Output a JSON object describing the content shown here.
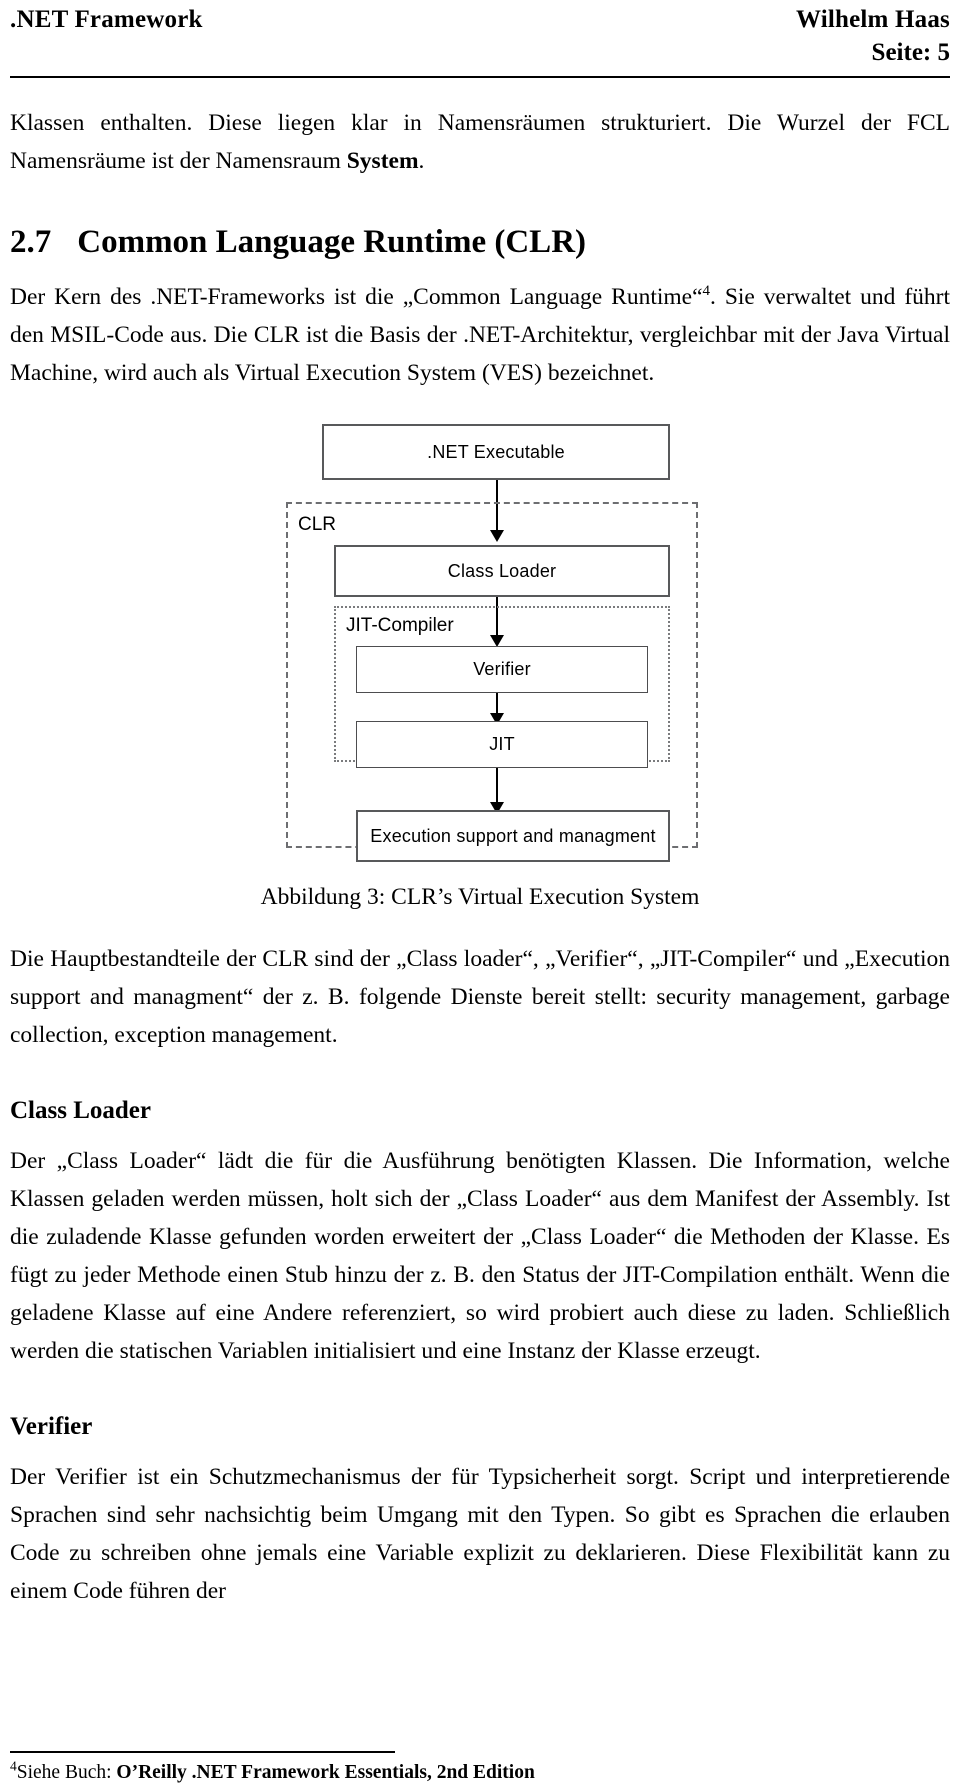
{
  "header": {
    "left_title": ".NET Framework",
    "author": "Wilhelm Haas",
    "page_label": "Seite: 5"
  },
  "body": {
    "para_continued_1": "Klassen enthalten. Diese liegen klar in Namensräumen strukturiert. Die Wurzel",
    "para_continued_2_pre": "der FCL Namensräume ist der Namensraum ",
    "para_continued_2_bold": "System",
    "para_continued_2_post": ".",
    "section_number": "2.7",
    "section_title": "Common Language Runtime (CLR)",
    "clr_intro_1": "Der Kern des .NET-Frameworks ist die „Common Language Runtime“",
    "clr_intro_footnote_marker": "4",
    "clr_intro_2": ". Sie verwaltet und führt den MSIL-Code aus. Die CLR ist die Basis der .NET-Architektur, vergleichbar mit der Java Virtual Machine, wird auch als Virtual Execution System (VES) bezeichnet.",
    "figure_caption": "Abbildung 3: CLR’s Virtual Execution System",
    "clr_parts_para": "Die Hauptbestandteile der CLR sind der „Class loader“, „Verifier“, „JIT-Compiler“ und „Execution support and managment“ der z. B. folgende Dienste bereit stellt: security management, garbage collection, exception management.",
    "class_loader_heading": "Class Loader",
    "class_loader_para": "Der „Class Loader“ lädt die für die Ausführung benötigten Klassen. Die Information, welche Klassen geladen werden müssen, holt sich der „Class Loader“ aus dem Manifest der Assembly. Ist die zuladende Klasse gefunden worden erweitert der „Class Loader“ die Methoden der Klasse. Es fügt zu jeder Methode einen Stub hinzu der z. B. den Status der JIT-Compilation enthält. Wenn die geladene Klasse auf eine Andere referenziert, so wird probiert auch diese zu laden. Schließlich werden die statischen Variablen initialisiert und eine Instanz der Klasse erzeugt.",
    "verifier_heading": "Verifier",
    "verifier_para": "Der Verifier ist ein Schutzmechanismus der für Typsicherheit sorgt. Script und interpretierende Sprachen sind sehr nachsichtig beim Umgang mit den Typen. So gibt es Sprachen die erlauben Code zu schreiben ohne jemals eine Variable explizit zu deklarieren. Diese Flexibilität kann zu einem Code führen der"
  },
  "figure": {
    "boxes": {
      "executable": ".NET Executable",
      "class_loader": "Class Loader",
      "verifier": "Verifier",
      "jit": "JIT",
      "execution_support": "Execution support and managment"
    },
    "group_labels": {
      "clr": "CLR",
      "jit_compiler": "JIT-Compiler"
    }
  },
  "footnote": {
    "marker": "4",
    "prefix": "Siehe Buch: ",
    "bold_text": "O’Reilly .NET Framework Essentials, 2nd Edition"
  },
  "colors": {
    "text": "#000000",
    "box_border": "#58595b",
    "group_border": "#6d6e71",
    "page_background": "#ffffff"
  }
}
